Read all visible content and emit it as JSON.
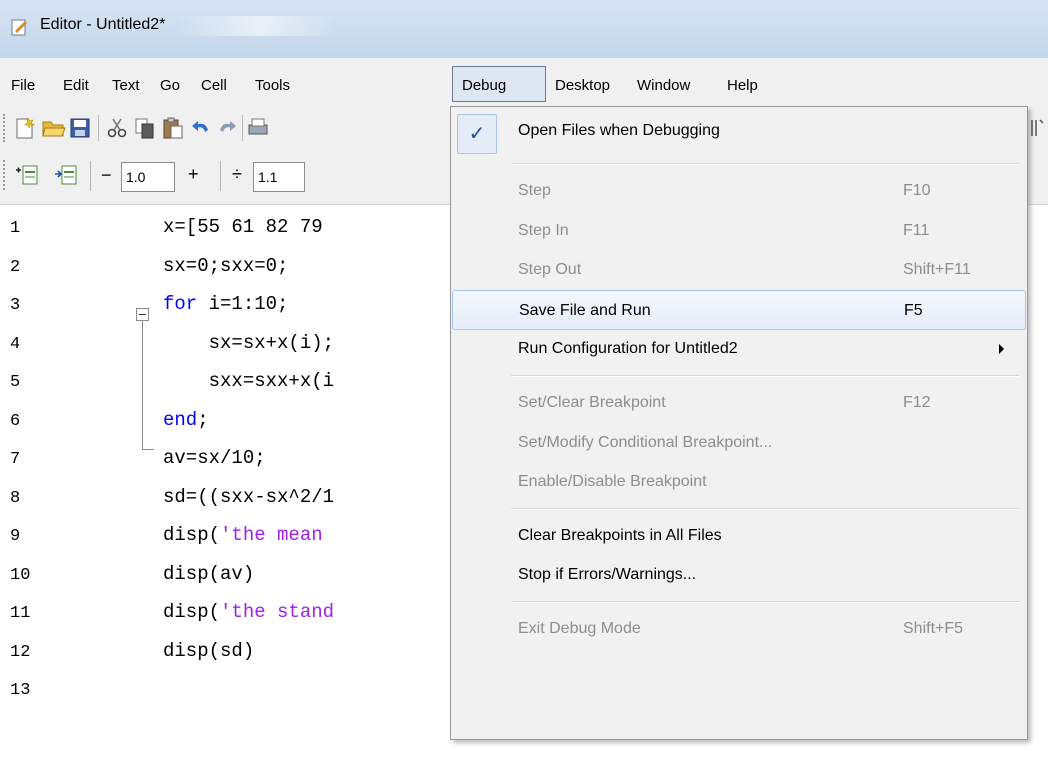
{
  "window": {
    "title": "Editor - Untitled2*"
  },
  "menubar": {
    "items": [
      "File",
      "Edit",
      "Text",
      "Go",
      "Cell",
      "Tools",
      "Debug",
      "Desktop",
      "Window",
      "Help"
    ],
    "active": "Debug"
  },
  "toolbar2": {
    "decrement_symbol": "−",
    "decrement_value": "1.0",
    "increment_symbol": "+",
    "divide_symbol": "÷",
    "divide_value": "1.1"
  },
  "editor": {
    "line_numbers": [
      "1",
      "2",
      "3",
      "4",
      "5",
      "6",
      "7",
      "8",
      "9",
      "10",
      "11",
      "12",
      "13"
    ],
    "lines": [
      {
        "parts": [
          {
            "t": "x=[55 61 82 79",
            "c": ""
          }
        ]
      },
      {
        "parts": [
          {
            "t": "sx=0;sxx=0;",
            "c": ""
          }
        ]
      },
      {
        "parts": [
          {
            "t": "for",
            "c": "kw"
          },
          {
            "t": " i=1:10;",
            "c": ""
          }
        ]
      },
      {
        "parts": [
          {
            "t": "    sx=sx+x(i);",
            "c": ""
          }
        ]
      },
      {
        "parts": [
          {
            "t": "    sxx=sxx+x(i",
            "c": ""
          }
        ]
      },
      {
        "parts": [
          {
            "t": "end",
            "c": "kw"
          },
          {
            "t": ";",
            "c": ""
          }
        ]
      },
      {
        "parts": [
          {
            "t": "av=sx/10;",
            "c": ""
          }
        ]
      },
      {
        "parts": [
          {
            "t": "sd=((sxx-sx^2/1",
            "c": ""
          }
        ]
      },
      {
        "parts": [
          {
            "t": "disp(",
            "c": ""
          },
          {
            "t": "'the mean",
            "c": "str"
          }
        ]
      },
      {
        "parts": [
          {
            "t": "disp(av)",
            "c": ""
          }
        ]
      },
      {
        "parts": [
          {
            "t": "disp(",
            "c": ""
          },
          {
            "t": "'the stand",
            "c": "str"
          }
        ]
      },
      {
        "parts": [
          {
            "t": "disp(sd)",
            "c": ""
          }
        ]
      },
      {
        "parts": []
      }
    ]
  },
  "debug_menu": {
    "items": [
      {
        "label": "Open Files when Debugging",
        "accel": "",
        "enabled": true,
        "checked": true
      },
      {
        "separator": true
      },
      {
        "label": "Step",
        "accel": "F10",
        "enabled": false
      },
      {
        "label": "Step In",
        "accel": "F11",
        "enabled": false
      },
      {
        "label": "Step Out",
        "accel": "Shift+F11",
        "enabled": false
      },
      {
        "label": "Save File and Run",
        "accel": "F5",
        "enabled": true,
        "highlighted": true
      },
      {
        "label": "Run Configuration for Untitled2",
        "accel": "",
        "enabled": true,
        "submenu": true
      },
      {
        "separator": true
      },
      {
        "label": "Set/Clear Breakpoint",
        "accel": "F12",
        "enabled": false
      },
      {
        "label": "Set/Modify Conditional Breakpoint...",
        "accel": "",
        "enabled": false
      },
      {
        "label": "Enable/Disable Breakpoint",
        "accel": "",
        "enabled": false
      },
      {
        "separator": true
      },
      {
        "label": "Clear Breakpoints in All Files",
        "accel": "",
        "enabled": true
      },
      {
        "label": "Stop if Errors/Warnings...",
        "accel": "",
        "enabled": true
      },
      {
        "separator": true
      },
      {
        "label": "Exit Debug Mode",
        "accel": "Shift+F5",
        "enabled": false
      }
    ]
  },
  "colors": {
    "keyword": "#0000ff",
    "string": "#a020f0",
    "disabled_text": "#8d8d8d",
    "highlight_border": "#a8c4e6"
  }
}
